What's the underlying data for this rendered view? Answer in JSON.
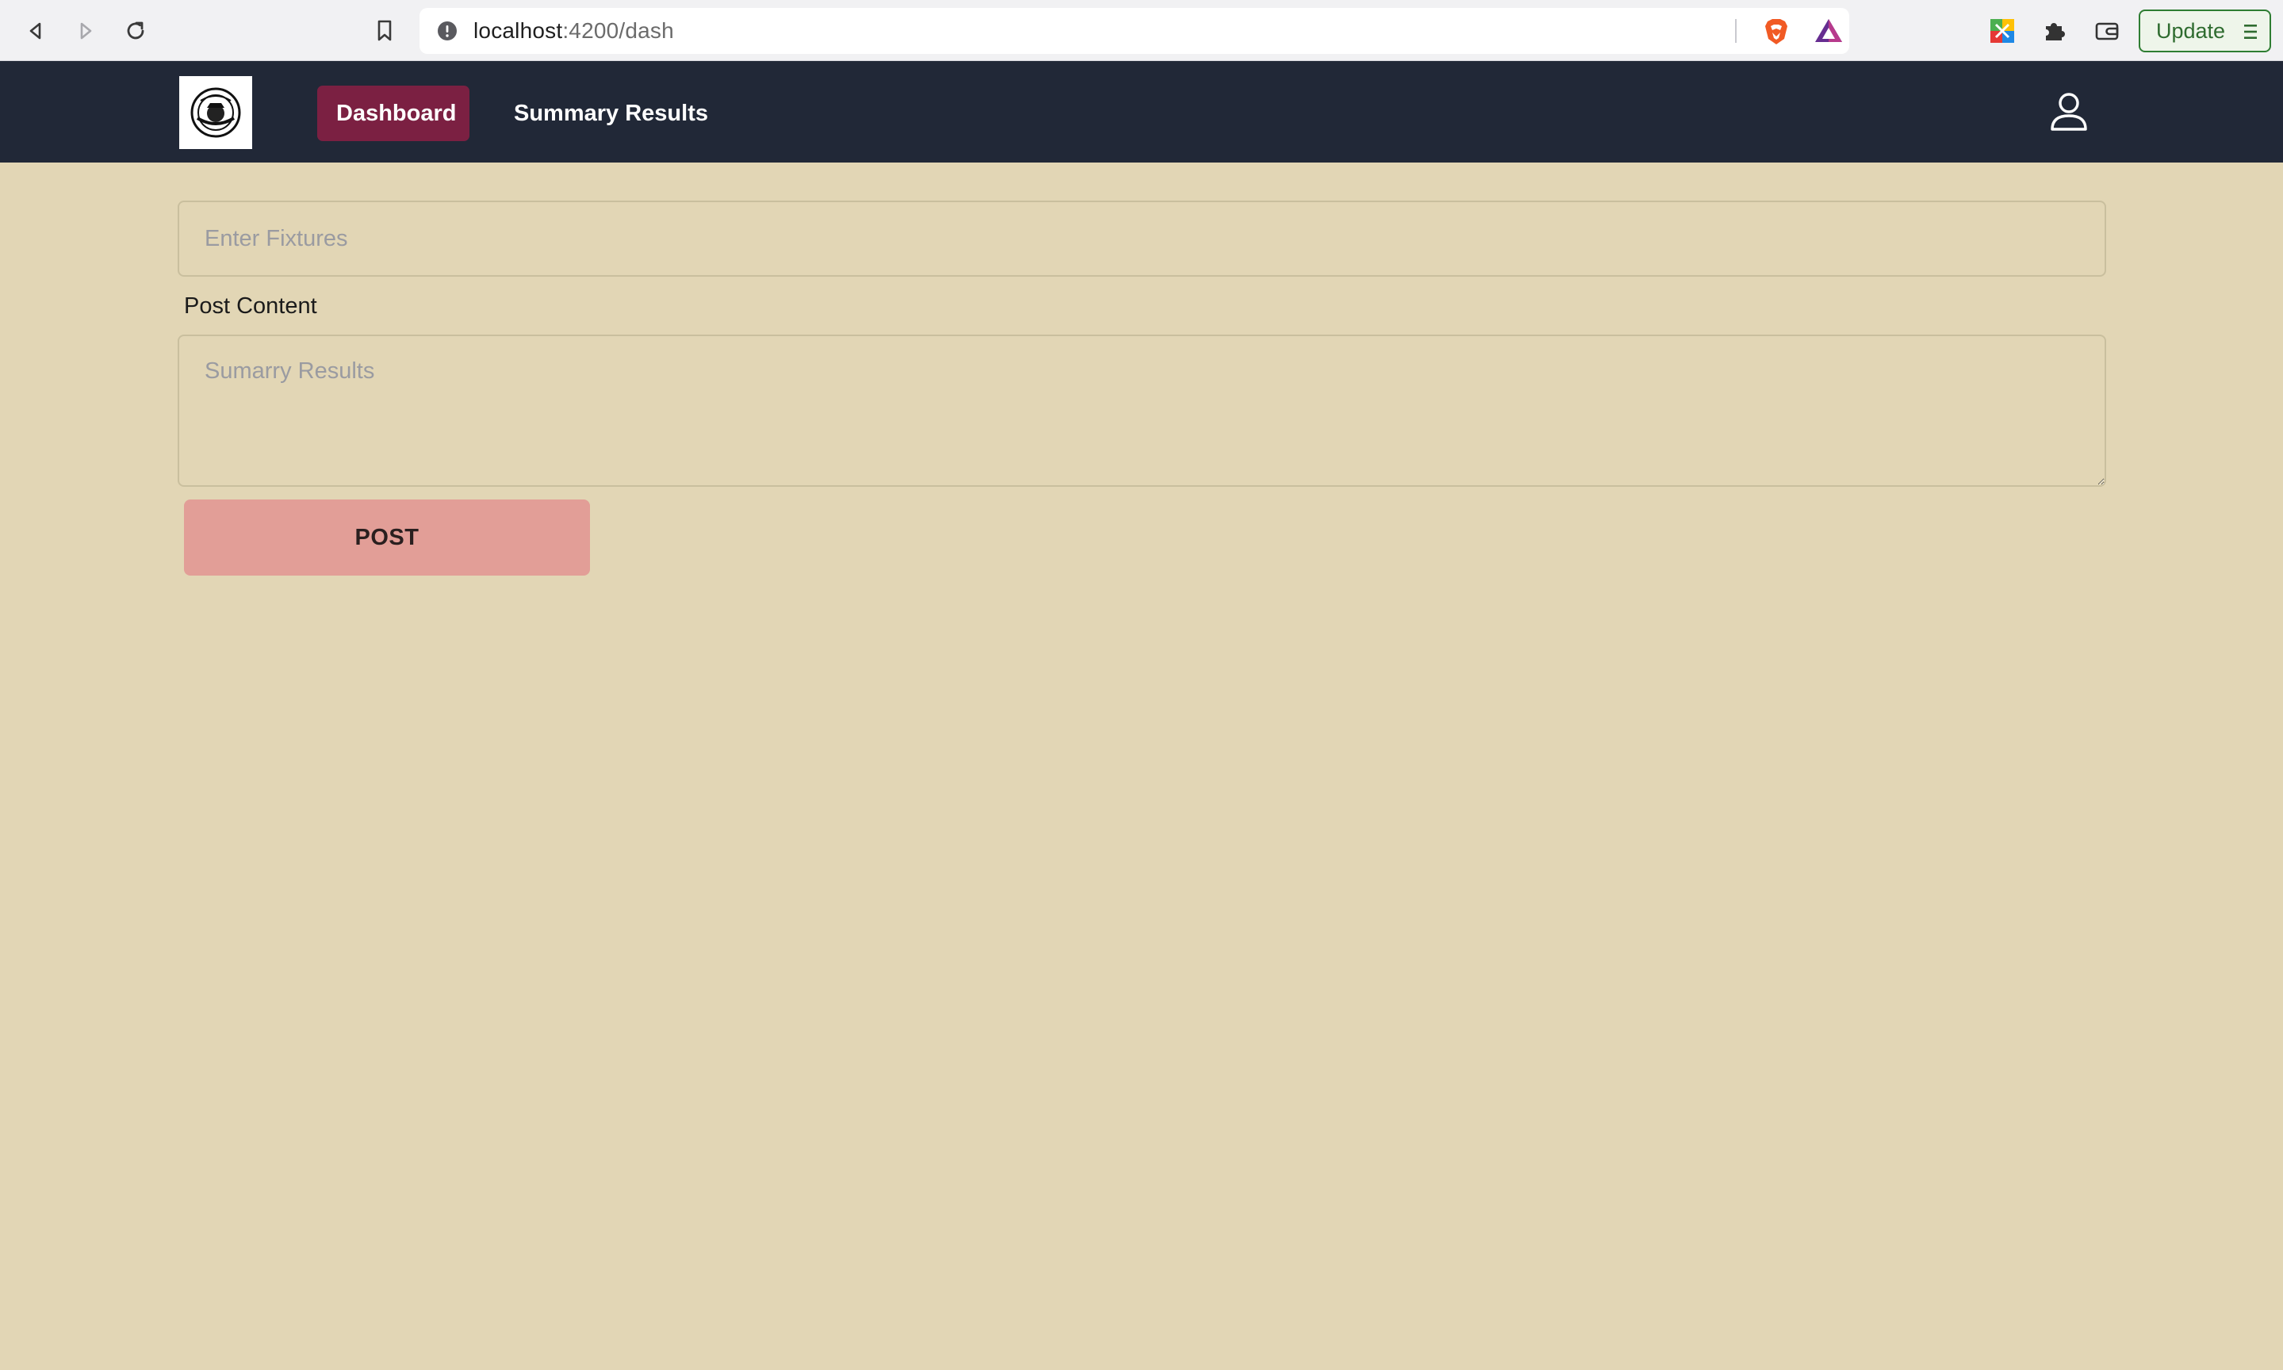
{
  "browser": {
    "url_host": "localhost",
    "url_path": ":4200/dash",
    "update_label": "Update",
    "icons": {
      "back": "arrow-left-icon",
      "forward": "arrow-right-icon",
      "reload": "reload-icon",
      "bookmark": "bookmark-icon",
      "site_info": "info-icon",
      "shields": "brave-shield-icon",
      "rewards": "brave-rewards-icon",
      "extension": "extension-icon",
      "puzzle": "puzzle-icon",
      "wallet": "wallet-icon",
      "menu": "hamburger-menu-icon"
    }
  },
  "navbar": {
    "items": [
      {
        "label": "Dashboard",
        "active": true
      },
      {
        "label": "Summary Results",
        "active": false
      }
    ],
    "colors": {
      "background": "#212837",
      "active_item": "#7b2042"
    }
  },
  "form": {
    "fixtures_placeholder": "Enter Fixtures",
    "fixtures_value": "",
    "post_content_label": "Post Content",
    "results_placeholder": "Sumarry Results",
    "results_value": "",
    "post_button_label": "POST",
    "colors": {
      "page_background": "#e2d6b5",
      "post_button": "#e29e97"
    }
  }
}
